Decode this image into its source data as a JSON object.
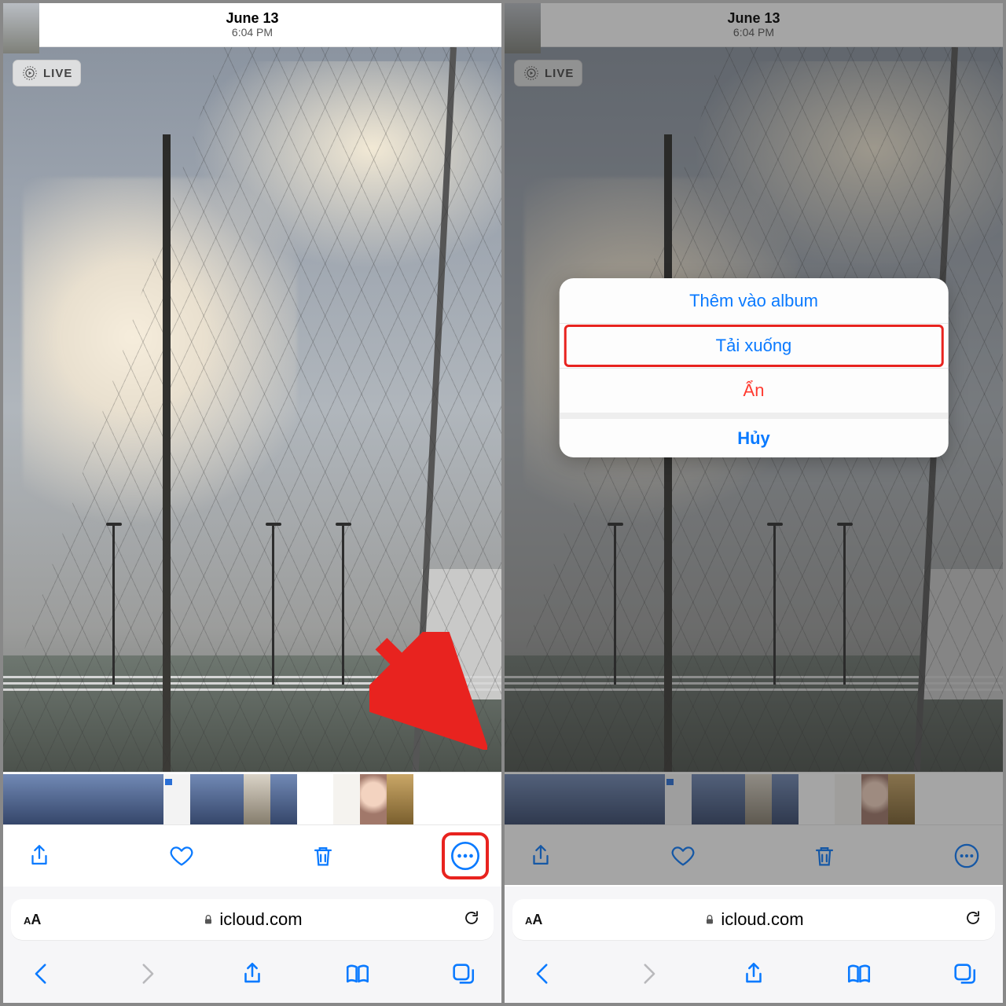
{
  "header": {
    "date": "June 13",
    "time": "6:04 PM"
  },
  "live_badge": "LIVE",
  "address_bar": {
    "domain": "icloud.com"
  },
  "toolbar_icons": {
    "share": "share-icon",
    "favorite": "heart-icon",
    "delete": "trash-icon",
    "more": "more-icon"
  },
  "browser_icons": {
    "back": "chevron-left-icon",
    "forward": "chevron-right-icon",
    "share": "share-icon",
    "bookmarks": "book-icon",
    "tabs": "tabs-icon"
  },
  "action_sheet": {
    "add_album": "Thêm vào album",
    "download": "Tải xuống",
    "hide": "Ẩn",
    "cancel": "Hủy"
  },
  "annotation": {
    "arrow_points_to": "more-button"
  }
}
